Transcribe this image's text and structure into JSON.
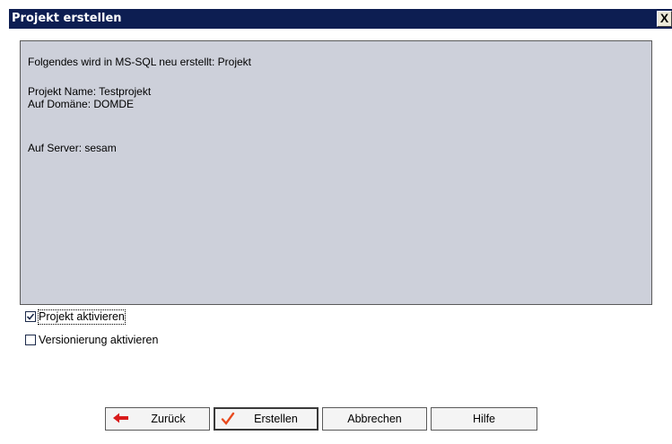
{
  "window": {
    "title": "Projekt erstellen",
    "close_label": "X"
  },
  "info": {
    "line1": "Folgendes wird in MS-SQL neu erstellt: Projekt",
    "line2": "Projekt Name: Testprojekt",
    "line3": "Auf Domäne: DOMDE",
    "line4": "Auf Server: sesam"
  },
  "options": {
    "activate_project": {
      "label": "Projekt aktivieren",
      "checked": true
    },
    "activate_versioning": {
      "label": "Versionierung aktivieren",
      "checked": false
    }
  },
  "buttons": {
    "back": "Zurück",
    "create": "Erstellen",
    "cancel": "Abbrechen",
    "help": "Hilfe"
  },
  "colors": {
    "titlebar": "#0d1e52",
    "panel": "#cdd0da",
    "back_arrow": "#d81b1b",
    "create_check": "#e84a1e"
  },
  "icons": {
    "back": "left-arrow-icon",
    "create": "checkmark-icon",
    "close": "close-icon"
  }
}
